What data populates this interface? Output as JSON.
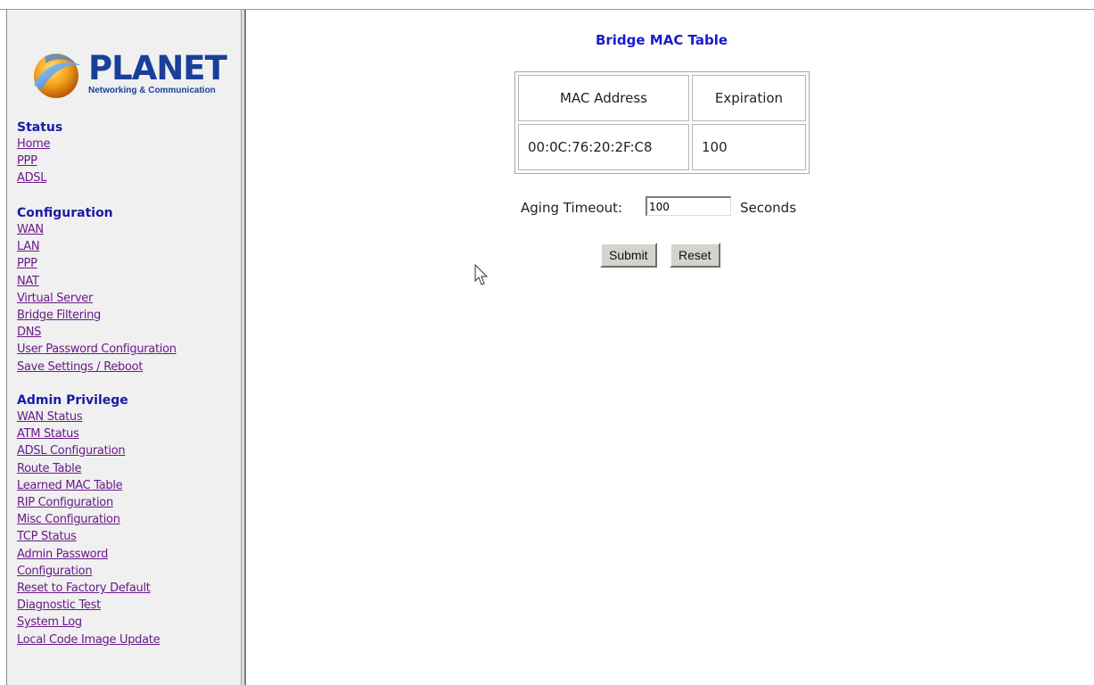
{
  "logo": {
    "name": "PLANET",
    "tagline": "Networking & Communication"
  },
  "sidebar": {
    "status": {
      "title": "Status",
      "links": [
        "Home",
        "PPP",
        "ADSL"
      ]
    },
    "configuration": {
      "title": "Configuration",
      "links": [
        "WAN",
        "LAN",
        "PPP",
        "NAT",
        "Virtual Server",
        "Bridge Filtering",
        "DNS",
        "User Password Configuration",
        "Save Settings / Reboot"
      ]
    },
    "admin": {
      "title": "Admin Privilege",
      "links": [
        "WAN Status",
        "ATM Status",
        "ADSL Configuration",
        "Route Table",
        "Learned MAC Table",
        "RIP Configuration",
        "Misc Configuration",
        "TCP Status",
        "Admin Password",
        "Configuration",
        "Reset to Factory Default",
        "Diagnostic Test",
        "System Log",
        "Local Code Image Update"
      ]
    }
  },
  "main": {
    "title": "Bridge MAC Table",
    "table": {
      "headers": [
        "MAC Address",
        "Expiration"
      ],
      "rows": [
        [
          "00:0C:76:20:2F:C8",
          "100"
        ]
      ]
    },
    "aging": {
      "label": "Aging Timeout:",
      "value": "100",
      "units": "Seconds"
    },
    "buttons": {
      "submit": "Submit",
      "reset": "Reset"
    }
  },
  "colors": {
    "title": "#1a1ad0",
    "section": "#1a1aa6",
    "link": "#6a1a8a",
    "logo": "#1a3f9a"
  }
}
